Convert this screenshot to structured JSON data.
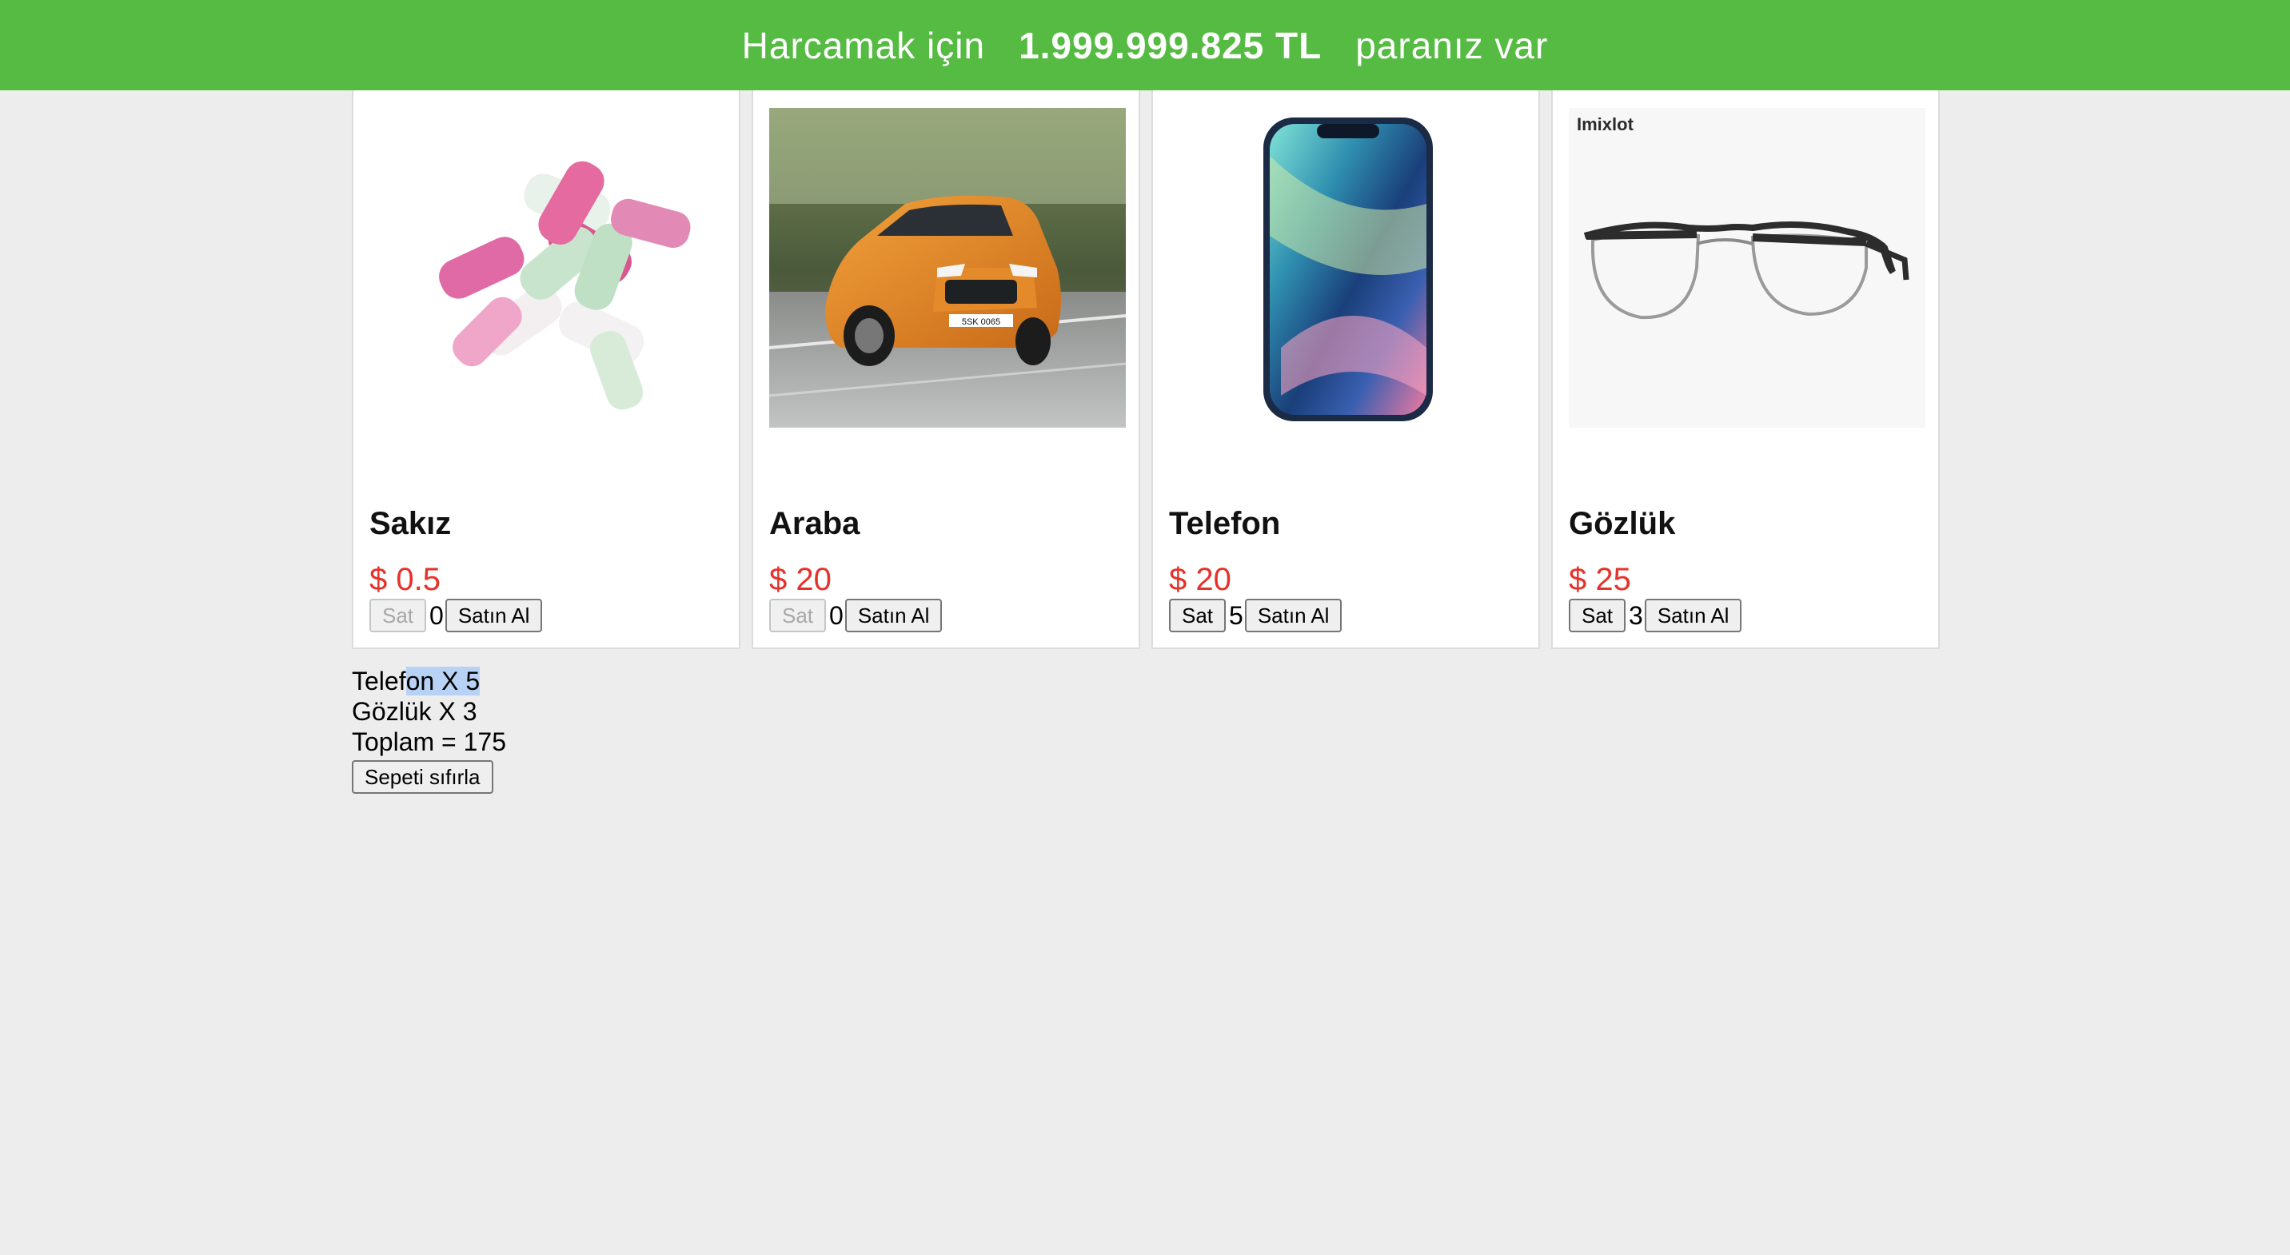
{
  "header": {
    "prefix": "Harcamak için",
    "money": "1.999.999.825 TL",
    "suffix": "paranız var",
    "bg_color": "#56bb43"
  },
  "products": [
    {
      "name": "Sakız",
      "price": "$ 0.5",
      "sell_label": "Sat",
      "sell_disabled": true,
      "count": "0",
      "buy_label": "Satın Al",
      "image": "gum-image"
    },
    {
      "name": "Araba",
      "price": "$ 20",
      "sell_label": "Sat",
      "sell_disabled": true,
      "count": "0",
      "buy_label": "Satın Al",
      "image": "car-image"
    },
    {
      "name": "Telefon",
      "price": "$ 20",
      "sell_label": "Sat",
      "sell_disabled": false,
      "count": "5",
      "buy_label": "Satın Al",
      "image": "phone-image"
    },
    {
      "name": "Gözlük",
      "price": "$ 25",
      "sell_label": "Sat",
      "sell_disabled": false,
      "count": "3",
      "buy_label": "Satın Al",
      "image": "glasses-image"
    }
  ],
  "glasses_brand": "Imixlot",
  "car_plate": "5SK 0065",
  "cart": {
    "items": [
      {
        "pre": "Telef",
        "sel": "on X 5"
      },
      {
        "pre": "Gözlük X 3",
        "sel": ""
      }
    ],
    "total": "Toplam = 175",
    "reset_label": "Sepeti sıfırla"
  },
  "colors": {
    "price": "#e5322a",
    "page_bg": "#ededed",
    "selection": "#b8d2f5"
  }
}
